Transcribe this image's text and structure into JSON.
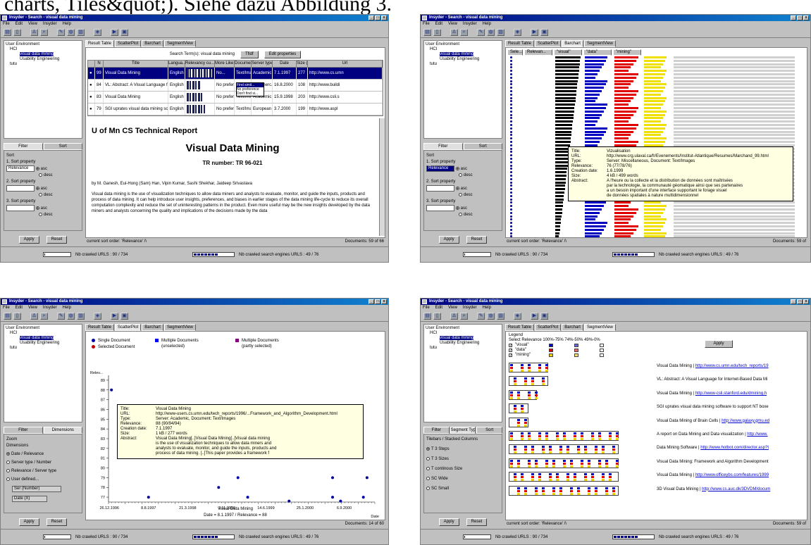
{
  "caption": {
    "text": "charts, Tiles&quot;). Siehe dazu Abbildung 3."
  },
  "window": {
    "title_s1": "Insyder - Search - visual data mining",
    "title_s2": "Insyder - Search - visual data mining",
    "title_s3": "Insyder - Search - visual data mining",
    "title_s4": "Insyder - Search - visual data mining",
    "menu": [
      "File",
      "Edit",
      "View",
      "Insyder",
      "Help"
    ],
    "winbtns": [
      "_",
      "□",
      "x"
    ]
  },
  "tree": {
    "root": "User Environment",
    "hci": "HCI",
    "selected": "visual data mining",
    "child2": "Usability Engineering",
    "other": "tutu"
  },
  "left_tabs": {
    "filter": "Filter",
    "sort": "Sort",
    "zoom": "Zoom",
    "dimensions": "Dimensions",
    "segment_types": "Segment Types"
  },
  "sort_panel": {
    "title": "Sort",
    "p1": "1. Sort property",
    "p1_value": "Relevance",
    "p2": "2. Sort property",
    "p3": "3. Sort property",
    "asc": "asc",
    "desc": "desc"
  },
  "buttons": {
    "apply": "Apply",
    "reset": "Reset",
    "tfidf": "Tfidf",
    "edit_properties": "Edit properties"
  },
  "main_tabs": [
    "Result Table",
    "ScatterPlot",
    "Barchart",
    "SegmentView"
  ],
  "status": {
    "sort_order": "current sort order: 'Relevance' /\\",
    "documents_s1": "Documents: 59 of 66",
    "documents_s2": "Documents: 59 of",
    "documents_s3": "Documents: 14 of 60",
    "documents_s4": "Documents: 59 of",
    "crawled_urls": "Nb crawled URLS : 90 / 734",
    "crawled_engines": "Nb crawled search engines URLS : 49 / 76",
    "progress_urls": 0.08,
    "progress_engines": 0.64
  },
  "result_table": {
    "search_label": "Search Term(s): visual data mining",
    "columns": [
      "",
      "N",
      "Title",
      "Langua...",
      "Relevancy cu...",
      "More Like...",
      "Documen...",
      "Server type",
      "Date",
      "Size (",
      "Url"
    ],
    "rows": [
      {
        "n": "99",
        "title": "Visual Data Mining",
        "lang": "English",
        "more": "No...",
        "doc": "Text/Ima...",
        "server": "Academic",
        "date": "7.1.1997",
        "size": "277",
        "url": "http://www.cs.umn"
      },
      {
        "n": "84",
        "title": "VL: Abstract: A Visual Language for Int...",
        "lang": "English",
        "more": "No preferen...",
        "doc": "Text/Ima...",
        "server": "Commerc...",
        "date": "16.8.2000",
        "size": "108",
        "url": "http://www.buildi"
      },
      {
        "n": "83",
        "title": "Visual Data Mining",
        "lang": "English",
        "more": "No prefere...",
        "doc": "Text/Ima...",
        "server": "Academic",
        "date": "15.9.1998",
        "size": "203",
        "url": "http://www.csli.s"
      },
      {
        "n": "79",
        "title": "SGI uprates visual data mining software...",
        "lang": "English",
        "more": "No prefere...",
        "doc": "Text/Ima...",
        "server": "European",
        "date": "3.7.2000",
        "size": "199",
        "url": "http://www.aspl"
      }
    ],
    "dropdown": [
      "Find simil...",
      "No preference",
      "Don't find si..."
    ]
  },
  "document": {
    "header": "U of Mn CS Technical Report",
    "title": "Visual Data Mining",
    "tr": "TR number: TR 96-021",
    "authors": "by M. Ganesh, Eui-Hong (Sam) Han, Vipin Kumar, Sashi Shekhar, Jaideep Srivastava",
    "abstract": "Visual data mining is the use of visualization techniques to allow data miners and analysts to evaluate, monitor, and guide the inputs, products and process of data mining. It can help introduce user insights, preferences, and biases in earlier stages of the data mining life-cycle to reduce its overall computation complexity and reduce the set of uninteresting patterns in the product. Even more useful may be the new insights developed by the data miners and analysts concerning the quality and implications of the decisions made by the data"
  },
  "barchart": {
    "headers": [
      "Sele...",
      "Relevan...",
      "\"visual\"",
      "\"data\"",
      "\"mining\""
    ],
    "colors": {
      "relevance": "#000000",
      "visual": "#0000c0",
      "data": "#e00000",
      "mining": "#f0e000"
    }
  },
  "tooltip_s2": {
    "rows": [
      [
        "Title:",
        "Vizualisation"
      ],
      [
        "URL:",
        "http://www.crg.ulaval.ca/fr/Evenements/Institut-Atlantique/Resumes/Marchand_99.html"
      ],
      [
        "Type:",
        "Server: Miscellaneous, Document: Text/Images"
      ],
      [
        "Relevance:",
        "76 (77/78/76)"
      ],
      [
        "Creation date:",
        "1.6.1999"
      ],
      [
        "Size:",
        "4 kB / 499 words"
      ],
      [
        "Abstract:",
        "A l'heure ou la collecte et la distribution de données sont maîtrisées"
      ]
    ],
    "more": [
      "par la technologie, la communauté géomatique ainsi que ses partenaires",
      "a un besoin important d'une interface supportant le forage visuel",
      "de données spatiales à nature multidimensionnel"
    ]
  },
  "scatter": {
    "legend": {
      "single": "Single Document",
      "multiple": "Multiple Documents",
      "multiple_sub": "(unselected)",
      "multiple_partly": "Multiple Documents",
      "multiple_partly_sub": "(partly selected)",
      "selected": "Selected Document"
    },
    "dims_title": "Dimensions",
    "dims": [
      "Date / Relevance",
      "Server type / Number",
      "Relevance / Server type",
      "User defined..."
    ],
    "dims_sel1": "Ser (Number)",
    "dims_sel2": "Date (X)",
    "ylabel": "Relev...",
    "xlabel": "Date",
    "selected_label": "Visual Data Mining",
    "selected_info": "Date = 8.1.1997 / Relevance = 88",
    "colors": {
      "single": "#0000a0",
      "selected": "#c00000",
      "multiple": "#0000ff",
      "partly": "#800080"
    }
  },
  "tooltip_s3": {
    "rows": [
      [
        "Title:",
        "Visual Data Mining"
      ],
      [
        "URL:",
        "http://www-users.cs.umn.edu/tech_reports/1996/...Framework_and_Algorithm_Development.html"
      ],
      [
        "Type:",
        "Server: Academic, Document: Text/Images"
      ],
      [
        "Relevance:",
        "88 (90/94/94)"
      ],
      [
        "Creation date:",
        "7.1.1997"
      ],
      [
        "Size:",
        "1 kB / 277 words"
      ],
      [
        "Abstract:",
        "Visual Data Mining[..]Visual Data Mining[..]Visual data mining"
      ]
    ],
    "more": [
      "is the use of visualization techniques to allow data miners and",
      "analysts to evaluate, monitor, and guide the inputs, products and",
      "process of data mining. [..]This paper provides a framework f"
    ]
  },
  "chart_data": {
    "type": "scatter",
    "xlabel": "Date",
    "ylabel": "Relev...",
    "x_ticks": [
      "26.12.1996",
      "8.8.1997",
      "21.3.1998",
      "1.11.1998",
      "14.6.1999",
      "25.1.2000",
      "6.9.2000"
    ],
    "y_ticks": [
      77,
      78,
      79,
      80,
      81,
      82,
      83,
      84,
      85,
      86,
      87,
      88,
      89
    ],
    "ylim": [
      76.5,
      89.5
    ],
    "points": [
      {
        "x": "7.1.1997",
        "y": 88,
        "kind": "selected"
      },
      {
        "x": "8.8.1997",
        "y": 77,
        "kind": "single"
      },
      {
        "x": "15.9.1998",
        "y": 78,
        "kind": "single"
      },
      {
        "x": "4.1.1999",
        "y": 79,
        "kind": "single"
      },
      {
        "x": "1.3.1999",
        "y": 77,
        "kind": "single"
      },
      {
        "x": "25.10.1999",
        "y": 76.6,
        "kind": "single"
      },
      {
        "x": "1.7.2000",
        "y": 77,
        "kind": "single"
      },
      {
        "x": "1.7.2000",
        "y": 79,
        "kind": "single"
      },
      {
        "x": "16.8.2000",
        "y": 76.6,
        "kind": "single"
      },
      {
        "x": "1.9.2000",
        "y": 84,
        "kind": "single"
      },
      {
        "x": "25.12.2000",
        "y": 77,
        "kind": "single"
      },
      {
        "x": "15.1.2001",
        "y": 79,
        "kind": "single"
      }
    ]
  },
  "segment": {
    "legend_title": "Legend",
    "select_header": "Select Relevance 100%-75%  74%-50%  49%-0%",
    "terms": [
      "\"visual\"",
      "\"data\"",
      "\"mining\""
    ],
    "term_colors": [
      "#0000c0",
      "#e00000",
      "#f0d000"
    ],
    "tiles_title": "Tilebars / Stacked Columns",
    "tiles": [
      "T 3 Steps",
      "T 3 Sizes",
      "T continous Size",
      "SC Wide",
      "SC Small"
    ],
    "rows": [
      {
        "title": "Visual Data Mining | ",
        "url": "http://www.cs.umn.edu/tech_reports/19",
        "w": 0.28
      },
      {
        "title": "VL: Abstract: A Visual Language for Internet-Based Data Mi",
        "url": "",
        "w": 0.28
      },
      {
        "title": "Visual Data Mining | ",
        "url": "http://www-csli.stanford.edu/dmining.h",
        "w": 0.2
      },
      {
        "title": "SGI uprates visual data mining software to support NT boxe",
        "url": "",
        "w": 0.14
      },
      {
        "title": "Visual Data Mining of Brain Cells | ",
        "url": "http://www.galaxy.gmu.ed",
        "w": 0.14
      },
      {
        "title": "A report on Data Mining and Data visualization | ",
        "url": "http://www.",
        "w": 0.78
      },
      {
        "title": "Data Mining Software | ",
        "url": "http://www.hotbot.com/director.asp?t",
        "w": 0.78
      },
      {
        "title": "Visual Data Mining: Framework and Algorithm Development",
        "url": "",
        "w": 0.78
      },
      {
        "title": "Visual Data Mining | ",
        "url": "http://www.officeybs.com/features/1999",
        "w": 0.78
      },
      {
        "title": "3D Visual Data Mining | ",
        "url": "http://www.cs.auc.dk/3DVDM/docum",
        "w": 0.78
      }
    ],
    "apply": "Apply"
  }
}
